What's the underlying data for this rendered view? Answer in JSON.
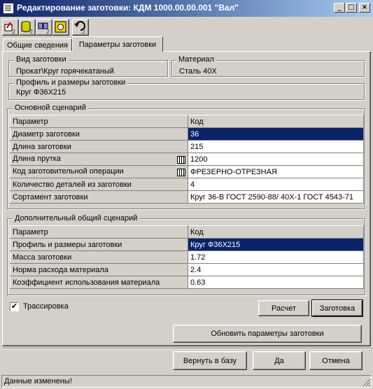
{
  "window": {
    "title": "Редактирование заготовки: КДМ 1000.00.00.001 \"Вал\"",
    "minimize": "_",
    "maximize": "□",
    "close": "×"
  },
  "toolbar": {
    "icons": [
      "assign-icon",
      "database-icon",
      "find-icon",
      "blank-icon",
      "undo-icon"
    ]
  },
  "tabs": [
    {
      "label": "Общие сведения"
    },
    {
      "label": "Параметры заготовки"
    }
  ],
  "blank_type": {
    "legend": "Вид заготовки",
    "value": "Прокат\\Круг горячекатаный"
  },
  "material": {
    "legend": "Материал",
    "value": "Сталь 40Х"
  },
  "profile": {
    "legend": "Профиль и размеры заготовки",
    "value": "Круг Ф36Х215"
  },
  "main_scenario": {
    "legend": "Основной сценарий",
    "header": {
      "param": "Параметр",
      "code": "Код"
    },
    "rows": [
      {
        "param": "Диаметр заготовки",
        "code": "36"
      },
      {
        "param": "Длина заготовки",
        "code": "215"
      },
      {
        "param": "Длина прутка",
        "code": "1200"
      },
      {
        "param": "Код заготовительной операции",
        "code": "ФРЕЗЕРНО-ОТРЕЗНАЯ"
      },
      {
        "param": "Количество деталей из заготовки",
        "code": "4"
      },
      {
        "param": "Сортамент заготовки",
        "code": "Круг  36-В ГОСТ 2590-88/ 40Х-1 ГОСТ 4543-71"
      }
    ]
  },
  "extra_scenario": {
    "legend": "Дополнительный общий сценарий",
    "header": {
      "param": "Параметр",
      "code": "Код"
    },
    "rows": [
      {
        "param": "Профиль и размеры заготовки",
        "code": "Круг Ф36Х215"
      },
      {
        "param": "Масса заготовки",
        "code": "1.72"
      },
      {
        "param": "Норма расхода материала",
        "code": "2.4"
      },
      {
        "param": "Коэффициент использования материала",
        "code": "0.63"
      }
    ]
  },
  "trace": {
    "label": "Трассировка",
    "checked": true,
    "mark": "✔"
  },
  "buttons": {
    "calc": "Расчет",
    "blank": "Заготовка",
    "update": "Обновить параметры заготовки",
    "return_db": "Вернуть в базу",
    "ok": "Да",
    "cancel": "Отмена"
  },
  "status": "Данные изменены!"
}
